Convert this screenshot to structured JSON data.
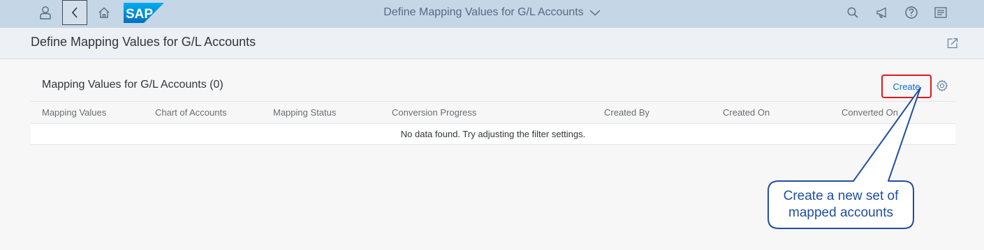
{
  "shell": {
    "title": "Define Mapping Values for G/L Accounts",
    "logo_text": "SAP",
    "icons": [
      "user-icon",
      "back-icon",
      "home-icon",
      "search-icon",
      "megaphone-icon",
      "help-icon",
      "menu-icon"
    ]
  },
  "header": {
    "title": "Define Mapping Values for G/L Accounts"
  },
  "table": {
    "title": "Mapping Values for G/L Accounts (0)",
    "create_label": "Create",
    "columns": [
      "Mapping Values",
      "Chart of Accounts",
      "Mapping Status",
      "Conversion Progress",
      "Created By",
      "Created On",
      "Converted On"
    ],
    "no_data": "No data found. Try adjusting the filter settings."
  },
  "callout": {
    "text": "Create a new set of mapped accounts"
  },
  "colors": {
    "shell_bg": "#c5d6e7",
    "header_bg": "#edf1f5",
    "accent": "#0a6ed1",
    "highlight": "#e0181c",
    "callout_border": "#1f4ea3"
  }
}
